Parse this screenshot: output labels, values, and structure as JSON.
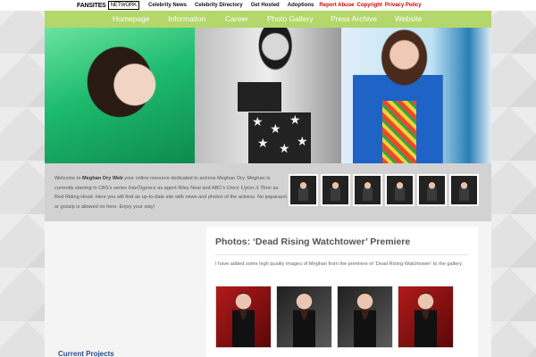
{
  "network": {
    "logo": "FANSITES",
    "logo_tag": "NETWORK",
    "links": [
      {
        "label": "Celebrity News",
        "color": "#111111"
      },
      {
        "label": "Celebrity Directory",
        "color": "#111111"
      },
      {
        "label": "Get Hosted",
        "color": "#111111"
      },
      {
        "label": "Adoptions",
        "color": "#111111"
      },
      {
        "label": "Report Abuse",
        "color": "#cc0000"
      },
      {
        "label": "Copyright",
        "color": "#cc0000"
      },
      {
        "label": "Privacy Policy",
        "color": "#cc0000"
      }
    ]
  },
  "nav": {
    "items": [
      "Homepage",
      "Information",
      "Career",
      "Photo Gallery",
      "Press Archive",
      "Website"
    ],
    "accent": "#b3d76a"
  },
  "intro": {
    "welcome": "Welcome to",
    "site_name": "Meghan Ory Web",
    "part1": "your online resource dedicated to actress Meghan Ory. Meghan is currently starring in CBS's series",
    "show1": "Intelligence",
    "part2": "as agent Riley Neal and ABC's",
    "show2": "Once Upon A Time",
    "part3": "as Red Riding Hood. Here you will find an up-to-date site with news and photos of the actress. No paparazzi or gossip is allowed on here. Enjoy your stay!"
  },
  "post": {
    "title": "Photos: ‘Dead Rising Watchtower’ Premiere",
    "body": "I have added some high quality images of Meghan from the premiere of ‘Dead Rising Watchtower’ to the gallery."
  },
  "sidebar": {
    "heading": "Current Projects"
  }
}
